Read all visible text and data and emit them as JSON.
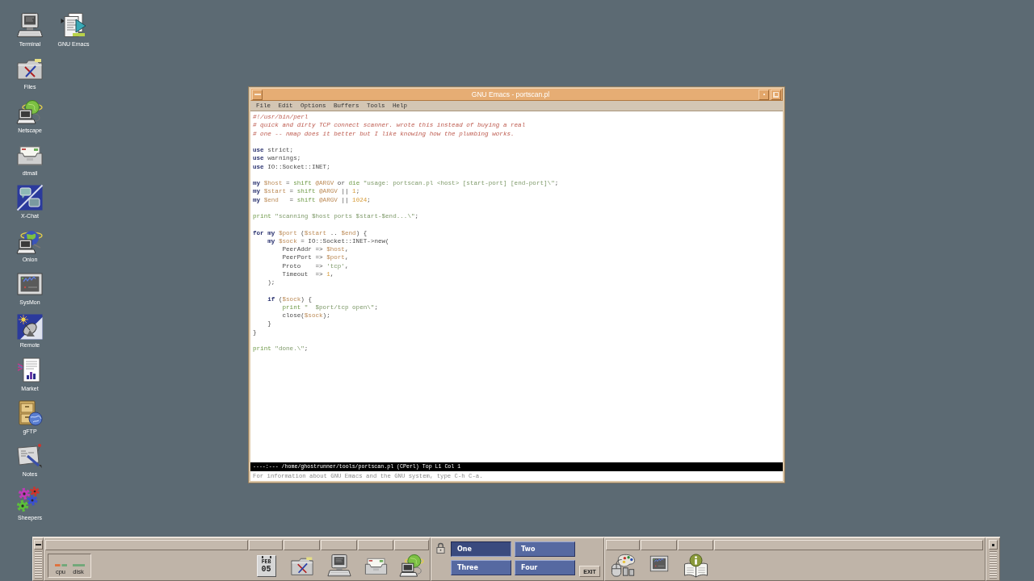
{
  "desktop_icon_columns": [
    {
      "icons": [
        {
          "label": "Terminal"
        },
        {
          "label": "Files"
        },
        {
          "label": "Netscape"
        },
        {
          "label": "dtmail"
        },
        {
          "label": "X-Chat"
        },
        {
          "label": "Onion"
        },
        {
          "label": "SysMon"
        },
        {
          "label": "Remote"
        },
        {
          "label": "Market"
        },
        {
          "label": "gFTP"
        },
        {
          "label": "Notes"
        },
        {
          "label": "Sheepers"
        }
      ]
    },
    {
      "icons": [
        {
          "label": "GNU Emacs"
        }
      ]
    }
  ],
  "emacs_window": {
    "title": "GNU Emacs - portscan.pl",
    "menu": [
      "File",
      "Edit",
      "Options",
      "Buffers",
      "Tools",
      "Help"
    ],
    "code_blocks": [
      {
        "lines": [
          [
            {
              "kind": "comment",
              "text": "#!/usr/bin/perl"
            }
          ],
          [
            {
              "kind": "comment",
              "text": "# quick and dirty TCP connect scanner. wrote this instead of buying a real"
            }
          ],
          [
            {
              "kind": "comment",
              "text": "# one -- nmap does it better but I like knowing how the plumbing works."
            }
          ]
        ]
      },
      {
        "lines": [
          [
            {
              "kind": "keyword",
              "text": "use"
            },
            {
              "kind": "plain",
              "text": " strict;"
            }
          ],
          [
            {
              "kind": "keyword",
              "text": "use"
            },
            {
              "kind": "plain",
              "text": " warnings;"
            }
          ],
          [
            {
              "kind": "keyword",
              "text": "use"
            },
            {
              "kind": "plain",
              "text": " IO::Socket::INET;"
            }
          ]
        ]
      },
      {
        "lines": [
          [
            {
              "kind": "keyword",
              "text": "my "
            },
            {
              "kind": "variable",
              "text": "$host"
            },
            {
              "kind": "plain",
              "text": " = "
            },
            {
              "kind": "builtin",
              "text": "shift "
            },
            {
              "kind": "variable",
              "text": "@ARGV"
            },
            {
              "kind": "plain",
              "text": " or "
            },
            {
              "kind": "builtin",
              "text": "die "
            },
            {
              "kind": "string",
              "text": "\"usage: portscan.pl <host> [start-port] [end-port]\\\""
            },
            {
              "kind": "plain",
              "text": ";"
            }
          ],
          [
            {
              "kind": "keyword",
              "text": "my "
            },
            {
              "kind": "variable",
              "text": "$start"
            },
            {
              "kind": "plain",
              "text": " = "
            },
            {
              "kind": "builtin",
              "text": "shift "
            },
            {
              "kind": "variable",
              "text": "@ARGV"
            },
            {
              "kind": "plain",
              "text": " || "
            },
            {
              "kind": "number",
              "text": "1"
            },
            {
              "kind": "plain",
              "text": ";"
            }
          ],
          [
            {
              "kind": "keyword",
              "text": "my "
            },
            {
              "kind": "variable",
              "text": "$end"
            },
            {
              "kind": "plain",
              "text": "   = "
            },
            {
              "kind": "builtin",
              "text": "shift "
            },
            {
              "kind": "variable",
              "text": "@ARGV"
            },
            {
              "kind": "plain",
              "text": " || "
            },
            {
              "kind": "number",
              "text": "1024"
            },
            {
              "kind": "plain",
              "text": ";"
            }
          ]
        ]
      },
      {
        "lines": [
          [
            {
              "kind": "builtin",
              "text": "print "
            },
            {
              "kind": "string",
              "text": "\"scanning $host ports $start-$end...\\\""
            },
            {
              "kind": "plain",
              "text": ";"
            }
          ]
        ]
      },
      {
        "lines": [
          [
            {
              "kind": "keyword",
              "text": "for my "
            },
            {
              "kind": "variable",
              "text": "$port"
            },
            {
              "kind": "plain",
              "text": " ("
            },
            {
              "kind": "variable",
              "text": "$start"
            },
            {
              "kind": "plain",
              "text": " .. "
            },
            {
              "kind": "variable",
              "text": "$end"
            },
            {
              "kind": "plain",
              "text": ") {"
            }
          ],
          [
            {
              "kind": "keyword",
              "text": "    my "
            },
            {
              "kind": "variable",
              "text": "$sock"
            },
            {
              "kind": "plain",
              "text": " = IO::Socket::INET->new("
            }
          ],
          [
            {
              "kind": "plain",
              "text": "        PeerAddr => "
            },
            {
              "kind": "variable",
              "text": "$host"
            },
            {
              "kind": "plain",
              "text": ","
            }
          ],
          [
            {
              "kind": "plain",
              "text": "        PeerPort => "
            },
            {
              "kind": "variable",
              "text": "$port"
            },
            {
              "kind": "plain",
              "text": ","
            }
          ],
          [
            {
              "kind": "plain",
              "text": "        Proto    => "
            },
            {
              "kind": "string",
              "text": "'tcp'"
            },
            {
              "kind": "plain",
              "text": ","
            }
          ],
          [
            {
              "kind": "plain",
              "text": "        Timeout  => "
            },
            {
              "kind": "number",
              "text": "1"
            },
            {
              "kind": "plain",
              "text": ","
            }
          ],
          [
            {
              "kind": "plain",
              "text": "    );"
            }
          ]
        ]
      },
      {
        "lines": [
          [
            {
              "kind": "keyword",
              "text": "    if"
            },
            {
              "kind": "plain",
              "text": " ("
            },
            {
              "kind": "variable",
              "text": "$sock"
            },
            {
              "kind": "plain",
              "text": ") {"
            }
          ],
          [
            {
              "kind": "builtin",
              "text": "        print "
            },
            {
              "kind": "string",
              "text": "\"  $port/tcp open\\\""
            },
            {
              "kind": "plain",
              "text": ";"
            }
          ],
          [
            {
              "kind": "plain",
              "text": "        close("
            },
            {
              "kind": "variable",
              "text": "$sock"
            },
            {
              "kind": "plain",
              "text": ");"
            }
          ],
          [
            {
              "kind": "plain",
              "text": "    }"
            }
          ],
          [
            {
              "kind": "plain",
              "text": "}"
            }
          ]
        ]
      },
      {
        "lines": [
          [
            {
              "kind": "builtin",
              "text": "print "
            },
            {
              "kind": "string",
              "text": "\"done.\\\""
            },
            {
              "kind": "plain",
              "text": ";"
            }
          ]
        ]
      }
    ],
    "mode_line": "----:--- /home/ghostrunner/tools/portscan.pl (CPerl) Top L1 Col 1",
    "echo_area": "For information about GNU Emacs and the GNU system, type C-h C-a."
  },
  "front_panel": {
    "load_meters": [
      {
        "label": "cpu"
      },
      {
        "label": "disk"
      }
    ],
    "calendar": {
      "month": "FEB",
      "day": "05"
    },
    "workspaces": [
      {
        "label": "One",
        "selected": true
      },
      {
        "label": "Two",
        "selected": false
      },
      {
        "label": "Three",
        "selected": false
      },
      {
        "label": "Four",
        "selected": false
      }
    ],
    "exit_button": "EXIT"
  }
}
